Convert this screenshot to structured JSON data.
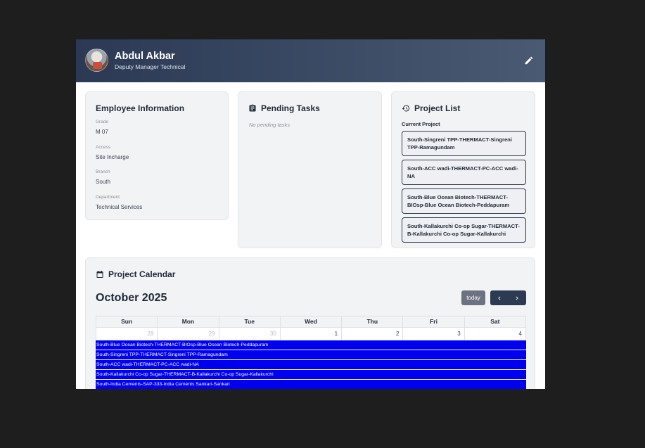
{
  "header": {
    "name": "Abdul Akbar",
    "role": "Deputy Manager Technical",
    "edit_icon": "pencil-icon"
  },
  "employee": {
    "title": "Employee Information",
    "fields": [
      {
        "label": "Grade",
        "value": "M 07"
      },
      {
        "label": "Access",
        "value": "Site Incharge"
      },
      {
        "label": "Branch",
        "value": "South"
      },
      {
        "label": "Department",
        "value": "Technical Services"
      }
    ]
  },
  "tasks": {
    "title": "Pending Tasks",
    "icon": "clipboard-icon",
    "empty_text": "No pending tasks"
  },
  "projects": {
    "title": "Project List",
    "icon": "history-icon",
    "current_label": "Current Project",
    "items": [
      "South-Singreni TPP-THERMACT-Singreni TPP-Ramagundam",
      "South-ACC wadi-THERMACT-PC-ACC wadi-NA",
      "South-Blue Ocean Biotech-THERMACT-BIOsp-Blue Ocean Biotech-Peddapuram",
      "South-Kallakurchi Co-op Sugar-THERMACT-B-Kallakurchi Co-op Sugar-Kallakurchi"
    ]
  },
  "calendar": {
    "title": "Project Calendar",
    "icon": "calendar-icon",
    "month": "October 2025",
    "today_label": "today",
    "weekdays": [
      "Sun",
      "Mon",
      "Tue",
      "Wed",
      "Thu",
      "Fri",
      "Sat"
    ],
    "first_week": [
      "28",
      "29",
      "30",
      "1",
      "2",
      "3",
      "4"
    ],
    "events": [
      "South-Blue Ocean Biotech-THERMACT-BIOsp-Blue Ocean Biotech-Peddapuram",
      "South-Singreni TPP-THERMACT-Singreni TPP-Ramagundam",
      "South-ACC wadi-THERMACT-PC-ACC wadi-NA",
      "South-Kallakurchi Co-op Sugar-THERMACT-B-Kallakurchi Co-op Sugar-Kallakurchi",
      "South-India Cements-SAP-333-India Cements Sankari-Sankari"
    ],
    "event_color": "#0000ee"
  },
  "colors": {
    "header_start": "#2b3954",
    "header_end": "#4a5a72",
    "nav_button": "#2c3a52",
    "today_button": "#6b7280"
  }
}
